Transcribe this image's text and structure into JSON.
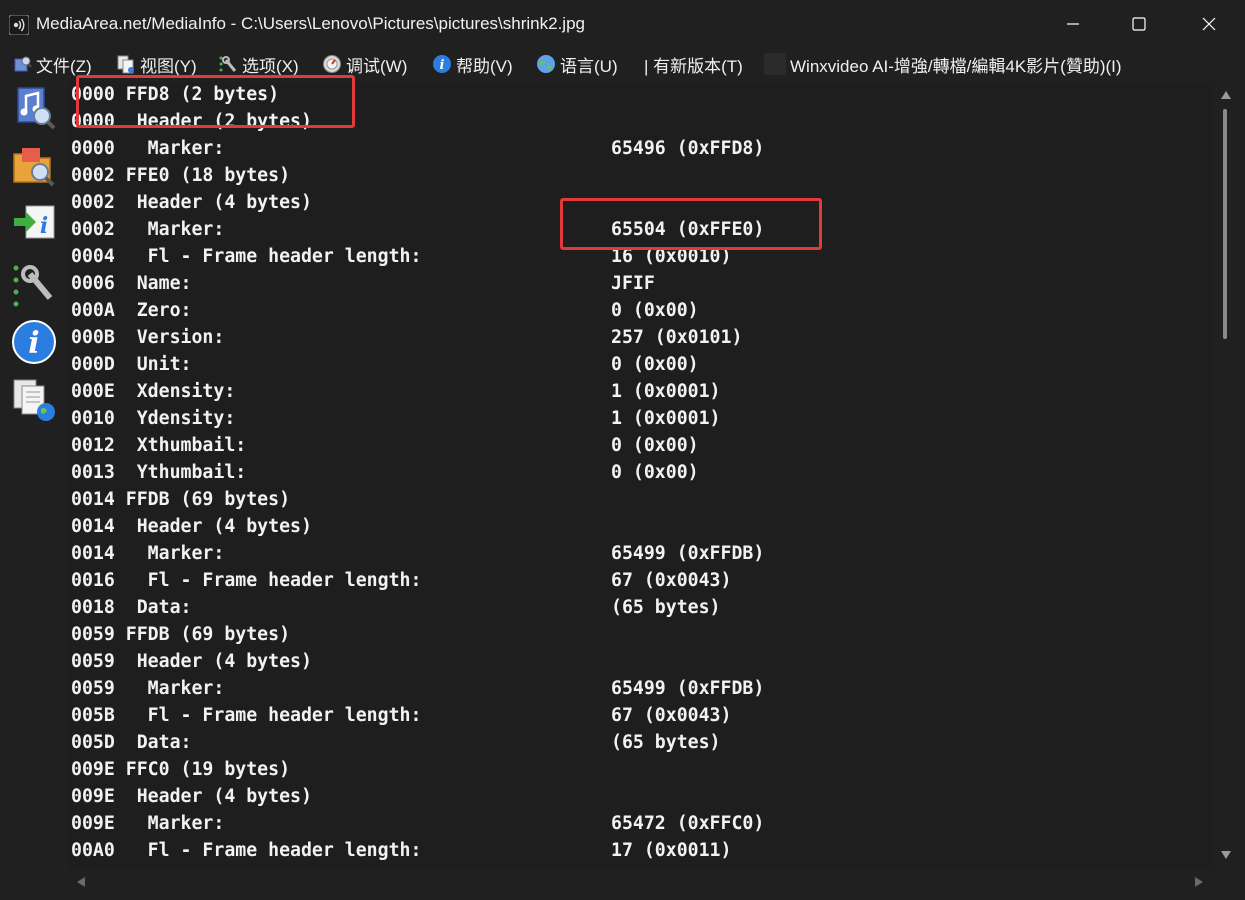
{
  "window": {
    "title": "MediaArea.net/MediaInfo - C:\\Users\\Lenovo\\Pictures\\pictures\\shrink2.jpg",
    "app_icon": "speaker-icon",
    "controls": {
      "minimize": "minimize-icon",
      "maximize": "maximize-icon",
      "close": "close-icon"
    }
  },
  "menubar": {
    "items": [
      {
        "label": "文件(Z)",
        "icon": "file-icon"
      },
      {
        "label": "视图(Y)",
        "icon": "view-icon"
      },
      {
        "label": "选项(X)",
        "icon": "options-icon"
      },
      {
        "label": "调试(W)",
        "icon": "debug-icon"
      },
      {
        "label": "帮助(V)",
        "icon": "help-icon"
      },
      {
        "label": "语言(U)",
        "icon": "language-icon"
      },
      {
        "label": "| 有新版本(T)",
        "icon": ""
      },
      {
        "label": "Winxvideo AI-增強/轉檔/編輯4K影片(贊助)(I)",
        "icon": "sponsor-icon"
      }
    ]
  },
  "sidebar": {
    "buttons": [
      {
        "name": "open-file-button",
        "icon": "music-file-icon"
      },
      {
        "name": "open-folder-button",
        "icon": "folder-search-icon"
      },
      {
        "name": "export-button",
        "icon": "export-info-icon"
      },
      {
        "name": "preferences-button",
        "icon": "wrench-icon"
      },
      {
        "name": "about-button",
        "icon": "info-icon"
      },
      {
        "name": "knowledge-button",
        "icon": "documents-globe-icon"
      }
    ]
  },
  "content": {
    "rows": [
      {
        "offset": "0000",
        "label": "FFD8 (2 bytes)",
        "value": "",
        "indent": 0
      },
      {
        "offset": "0000",
        "label": "Header (2 bytes)",
        "value": "",
        "indent": 1
      },
      {
        "offset": "0000",
        "label": "Marker:",
        "value": "65496 (0xFFD8)",
        "indent": 2
      },
      {
        "offset": "0002",
        "label": "FFE0 (18 bytes)",
        "value": "",
        "indent": 0
      },
      {
        "offset": "0002",
        "label": "Header (4 bytes)",
        "value": "",
        "indent": 1
      },
      {
        "offset": "0002",
        "label": "Marker:",
        "value": "65504 (0xFFE0)",
        "indent": 2
      },
      {
        "offset": "0004",
        "label": "Fl - Frame header length:",
        "value": "16 (0x0010)",
        "indent": 2
      },
      {
        "offset": "0006",
        "label": "Name:",
        "value": "JFIF",
        "indent": 1
      },
      {
        "offset": "000A",
        "label": "Zero:",
        "value": "0 (0x00)",
        "indent": 1
      },
      {
        "offset": "000B",
        "label": "Version:",
        "value": "257 (0x0101)",
        "indent": 1
      },
      {
        "offset": "000D",
        "label": "Unit:",
        "value": "0 (0x00)",
        "indent": 1
      },
      {
        "offset": "000E",
        "label": "Xdensity:",
        "value": "1 (0x0001)",
        "indent": 1
      },
      {
        "offset": "0010",
        "label": "Ydensity:",
        "value": "1 (0x0001)",
        "indent": 1
      },
      {
        "offset": "0012",
        "label": "Xthumbail:",
        "value": "0 (0x00)",
        "indent": 1
      },
      {
        "offset": "0013",
        "label": "Ythumbail:",
        "value": "0 (0x00)",
        "indent": 1
      },
      {
        "offset": "0014",
        "label": "FFDB (69 bytes)",
        "value": "",
        "indent": 0
      },
      {
        "offset": "0014",
        "label": "Header (4 bytes)",
        "value": "",
        "indent": 1
      },
      {
        "offset": "0014",
        "label": "Marker:",
        "value": "65499 (0xFFDB)",
        "indent": 2
      },
      {
        "offset": "0016",
        "label": "Fl - Frame header length:",
        "value": "67 (0x0043)",
        "indent": 2
      },
      {
        "offset": "0018",
        "label": "Data:",
        "value": "(65 bytes)",
        "indent": 1
      },
      {
        "offset": "0059",
        "label": "FFDB (69 bytes)",
        "value": "",
        "indent": 0
      },
      {
        "offset": "0059",
        "label": "Header (4 bytes)",
        "value": "",
        "indent": 1
      },
      {
        "offset": "0059",
        "label": "Marker:",
        "value": "65499 (0xFFDB)",
        "indent": 2
      },
      {
        "offset": "005B",
        "label": "Fl - Frame header length:",
        "value": "67 (0x0043)",
        "indent": 2
      },
      {
        "offset": "005D",
        "label": "Data:",
        "value": "(65 bytes)",
        "indent": 1
      },
      {
        "offset": "009E",
        "label": "FFC0 (19 bytes)",
        "value": "",
        "indent": 0
      },
      {
        "offset": "009E",
        "label": "Header (4 bytes)",
        "value": "",
        "indent": 1
      },
      {
        "offset": "009E",
        "label": "Marker:",
        "value": "65472 (0xFFC0)",
        "indent": 2
      },
      {
        "offset": "00A0",
        "label": "Fl - Frame header length:",
        "value": "17 (0x0011)",
        "indent": 2
      }
    ]
  },
  "colors": {
    "background": "#1e1e1e",
    "text": "#f2f2f2",
    "annotation": "#e23a3a"
  }
}
